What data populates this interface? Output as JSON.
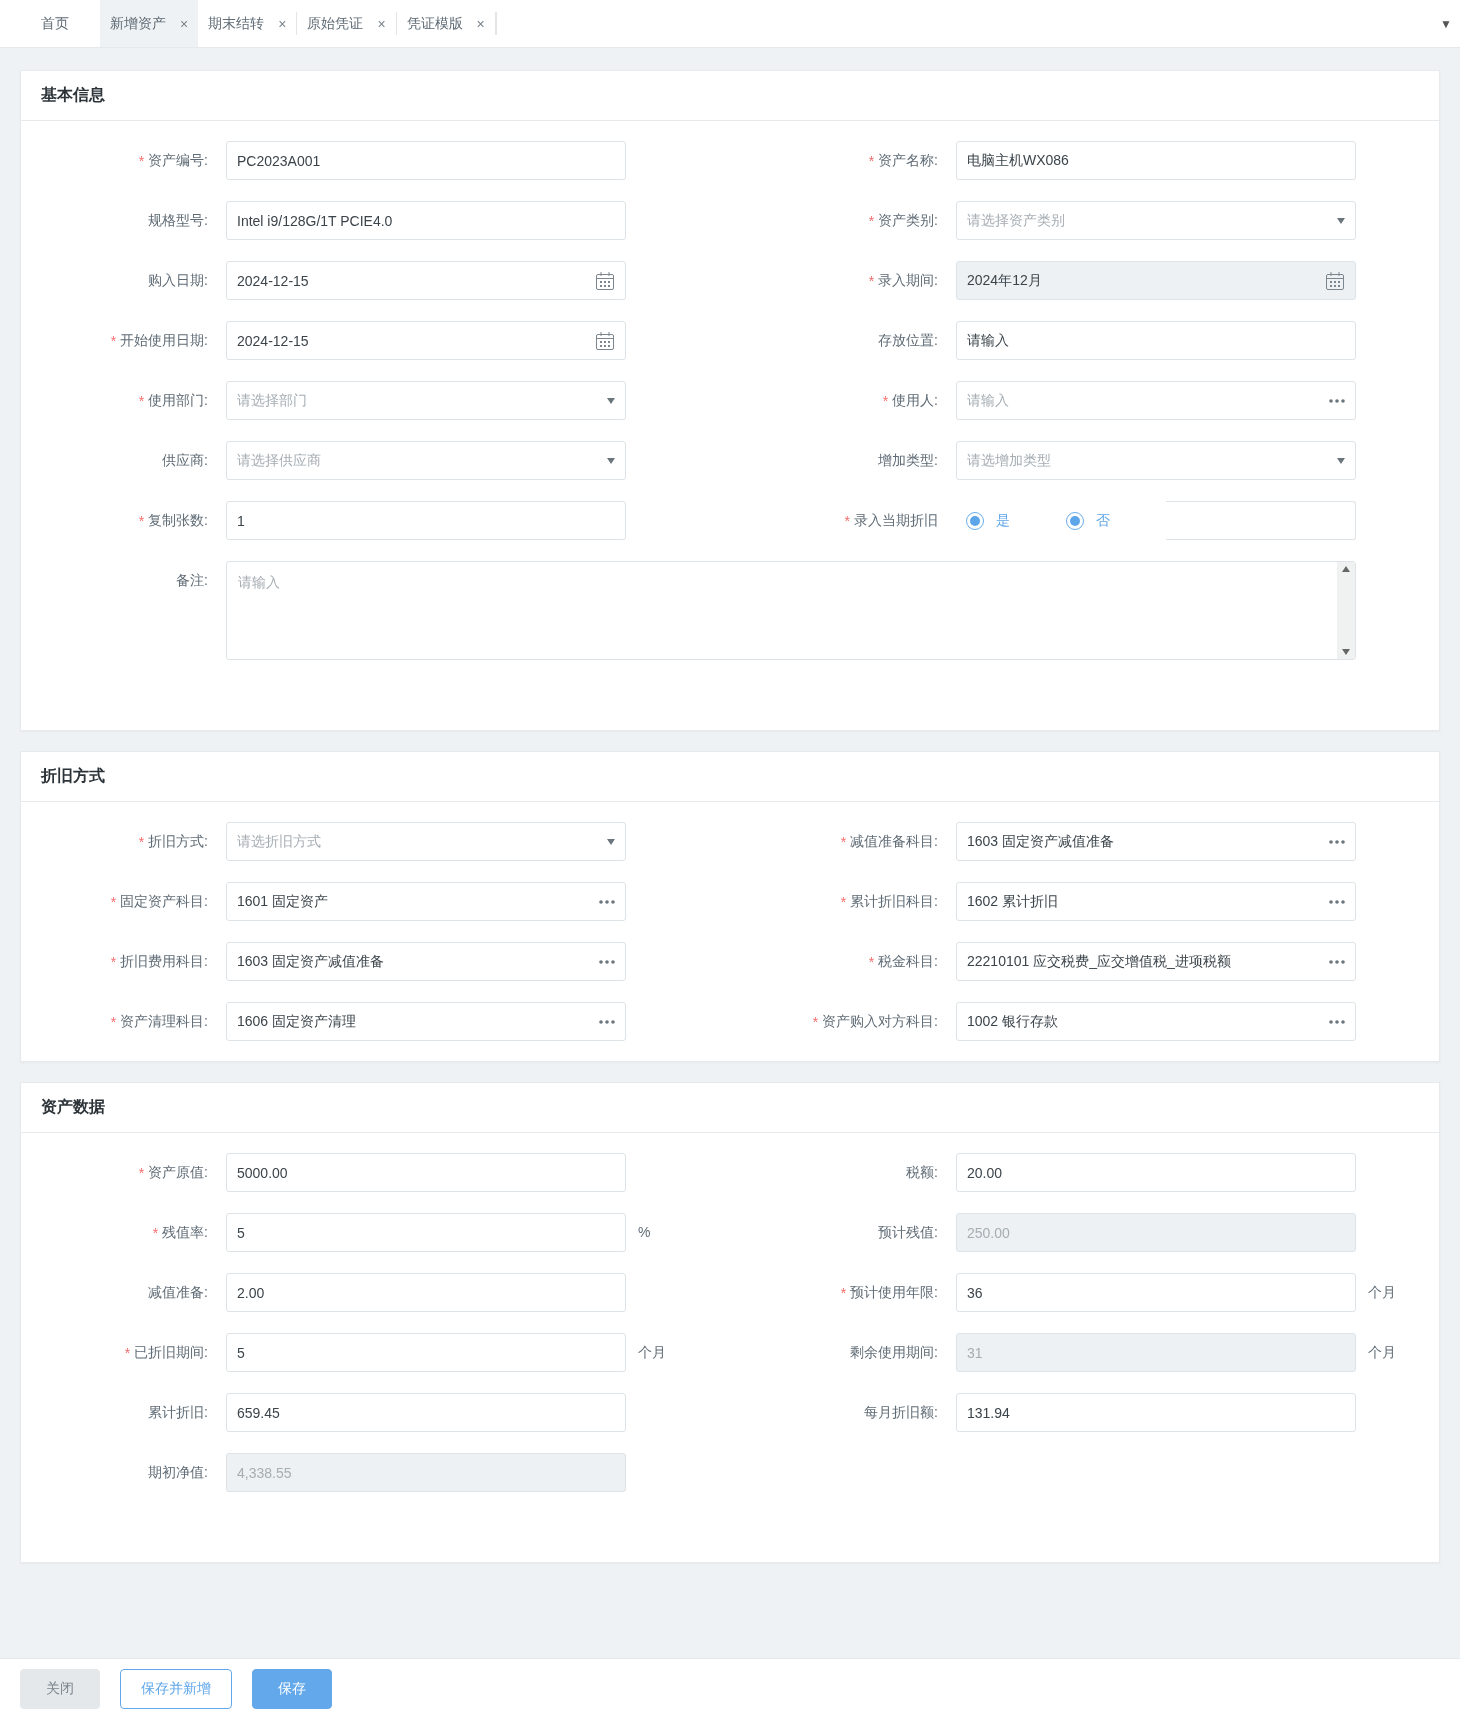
{
  "tabs": [
    {
      "label": "首页",
      "selected": false
    },
    {
      "label": "新增资产",
      "selected": true,
      "close": "×"
    },
    {
      "label": "期末结转",
      "selected": false,
      "close": "×"
    },
    {
      "label": "原始凭证",
      "selected": false,
      "close": "×"
    },
    {
      "label": "凭证模版",
      "selected": false,
      "close": "×"
    }
  ],
  "tab_menu": "▼",
  "sections": [
    {
      "title": "基本信息",
      "fields": [
        {
          "label": "资产编号:",
          "required_mark": "*",
          "kind": "text",
          "value": "PC2023A001"
        },
        {
          "label": "资产名称:",
          "required_mark": "*",
          "kind": "text",
          "value": "电脑主机WX086"
        },
        {
          "label": "规格型号:",
          "kind": "text",
          "value": "Intel i9/128G/1T PCIE4.0"
        },
        {
          "label": "资产类别:",
          "required_mark": "*",
          "kind": "select",
          "placeholder": "请选择资产类别"
        },
        {
          "label": "购入日期:",
          "kind": "date",
          "value": "2024-12-15"
        },
        {
          "label": "录入期间:",
          "required_mark": "*",
          "kind": "date",
          "value": "2024年12月",
          "readonly": true
        },
        {
          "label": "开始使用日期:",
          "required_mark": "*",
          "kind": "date",
          "value": "2024-12-15"
        },
        {
          "label": "存放位置:",
          "kind": "text",
          "value": "请输入"
        },
        {
          "label": "使用部门:",
          "required_mark": "*",
          "kind": "select",
          "placeholder": "请选择部门"
        },
        {
          "label": "使用人:",
          "required_mark": "*",
          "kind": "picker",
          "placeholder": "请输入"
        },
        {
          "label": "供应商:",
          "kind": "select",
          "placeholder": "请选择供应商"
        },
        {
          "label": "增加类型:",
          "kind": "select",
          "placeholder": "请选增加类型"
        },
        {
          "label": "复制张数:",
          "required_mark": "*",
          "kind": "text",
          "value": "1"
        },
        {
          "label": "录入当期折旧",
          "required_mark": "*",
          "kind": "radio",
          "options": [
            {
              "label": "是",
              "selected": true
            },
            {
              "label": "否",
              "selected": true
            }
          ]
        },
        {
          "label": "备注:",
          "kind": "textarea",
          "placeholder": "请输入"
        }
      ]
    },
    {
      "title": "折旧方式",
      "fields": [
        {
          "label": "折旧方式:",
          "required_mark": "*",
          "kind": "select",
          "placeholder": "请选折旧方式"
        },
        {
          "label": "减值准备科目:",
          "required_mark": "*",
          "kind": "picker",
          "value": "1603 固定资产减值准备"
        },
        {
          "label": "固定资产科目:",
          "required_mark": "*",
          "kind": "picker",
          "value": "1601 固定资产"
        },
        {
          "label": "累计折旧科目:",
          "required_mark": "*",
          "kind": "picker",
          "value": "1602 累计折旧"
        },
        {
          "label": "折旧费用科目:",
          "required_mark": "*",
          "kind": "picker",
          "value": "1603 固定资产减值准备"
        },
        {
          "label": "税金科目:",
          "required_mark": "*",
          "kind": "picker",
          "value": "22210101 应交税费_应交增值税_进项税额"
        },
        {
          "label": "资产清理科目:",
          "required_mark": "*",
          "kind": "picker",
          "value": "1606 固定资产清理"
        },
        {
          "label": "资产购入对方科目:",
          "required_mark": "*",
          "kind": "picker",
          "value": "1002 银行存款"
        }
      ]
    },
    {
      "title": "资产数据",
      "fields": [
        {
          "label": "资产原值:",
          "required_mark": "*",
          "kind": "text",
          "value": "5000.00"
        },
        {
          "label": "税额:",
          "kind": "text",
          "value": "20.00"
        },
        {
          "label": "残值率:",
          "required_mark": "*",
          "kind": "text",
          "value": "5",
          "suffix": "%"
        },
        {
          "label": "预计残值:",
          "kind": "text",
          "value": "250.00",
          "disabled": true
        },
        {
          "label": "减值准备:",
          "kind": "text",
          "value": "2.00"
        },
        {
          "label": "预计使用年限:",
          "required_mark": "*",
          "kind": "text",
          "value": "36",
          "suffix": "个月"
        },
        {
          "label": "已折旧期间:",
          "required_mark": "*",
          "kind": "text",
          "value": "5",
          "suffix": "个月"
        },
        {
          "label": "剩余使用期间:",
          "kind": "text",
          "value": "31",
          "suffix": "个月",
          "disabled": true
        },
        {
          "label": "累计折旧:",
          "kind": "text",
          "value": "659.45"
        },
        {
          "label": "每月折旧额:",
          "kind": "text",
          "value": "131.94"
        },
        {
          "label": "期初净值:",
          "kind": "text",
          "value": "4,338.55",
          "disabled": true
        }
      ]
    }
  ],
  "buttons": [
    {
      "label": "关闭",
      "kind": "default"
    },
    {
      "label": "保存并新增",
      "kind": "outline"
    },
    {
      "label": "保存",
      "kind": "primary"
    }
  ]
}
